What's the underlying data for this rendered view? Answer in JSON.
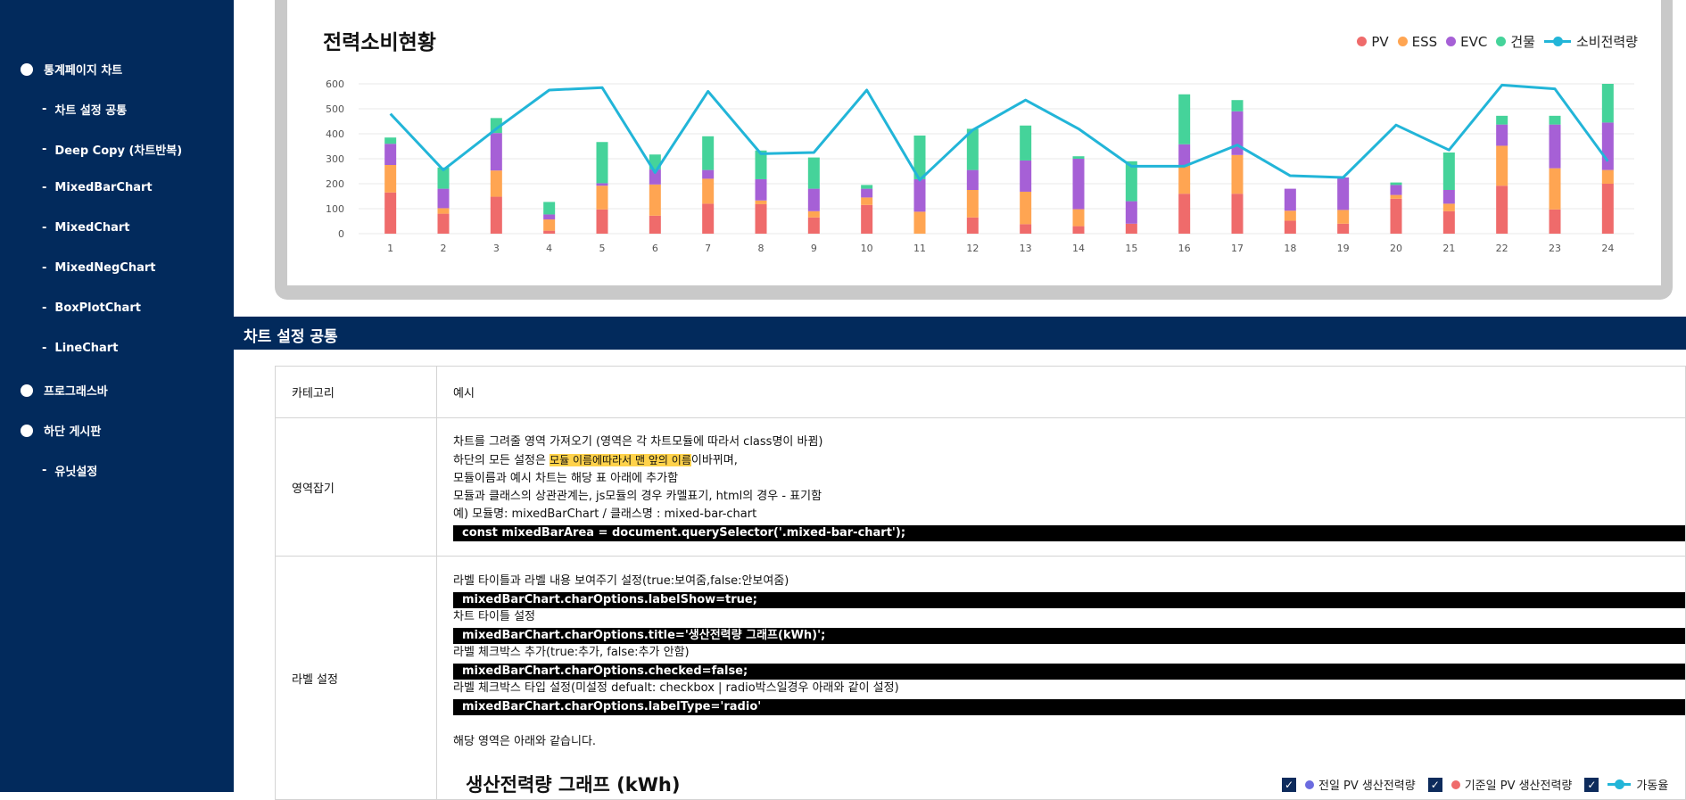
{
  "sidebar": {
    "items": [
      {
        "label": "통계페이지 차트",
        "level": "top"
      },
      {
        "label": "차트 설정 공통",
        "level": "sub"
      },
      {
        "label": "Deep Copy (차트반복)",
        "level": "sub"
      },
      {
        "label": "MixedBarChart",
        "level": "sub"
      },
      {
        "label": "MixedChart",
        "level": "sub"
      },
      {
        "label": "MixedNegChart",
        "level": "sub"
      },
      {
        "label": "BoxPlotChart",
        "level": "sub"
      },
      {
        "label": "LineChart",
        "level": "sub"
      },
      {
        "label": "프로그래스바",
        "level": "top"
      },
      {
        "label": "하단 게시판",
        "level": "top"
      },
      {
        "label": "유닛설정",
        "level": "sub"
      }
    ]
  },
  "chart": {
    "title": "전력소비현황",
    "legend": [
      {
        "label": "PV",
        "color": "#ef6b6b",
        "kind": "dot"
      },
      {
        "label": "ESS",
        "color": "#ffa552",
        "kind": "dot"
      },
      {
        "label": "EVC",
        "color": "#a660d6",
        "kind": "dot"
      },
      {
        "label": "건물",
        "color": "#45d39a",
        "kind": "dot"
      },
      {
        "label": "소비전력량",
        "color": "#22b5d8",
        "kind": "line"
      }
    ]
  },
  "chart_data": {
    "type": "bar",
    "title": "전력소비현황",
    "categories": [
      "1",
      "2",
      "3",
      "4",
      "5",
      "6",
      "7",
      "8",
      "9",
      "10",
      "11",
      "12",
      "13",
      "14",
      "15",
      "16",
      "17",
      "18",
      "19",
      "20",
      "21",
      "22",
      "23",
      "24"
    ],
    "ylim": [
      0,
      600
    ],
    "yticks": [
      0,
      100,
      200,
      300,
      400,
      500,
      600
    ],
    "grid": true,
    "legend_position": "top-right",
    "stacked": true,
    "series": [
      {
        "name": "PV",
        "color": "#ef6b6b",
        "values": [
          165,
          80,
          148,
          12,
          97,
          72,
          120,
          118,
          65,
          115,
          0,
          65,
          38,
          30,
          40,
          160,
          160,
          52,
          40,
          140,
          90,
          192,
          97,
          200
        ]
      },
      {
        "name": "ESS",
        "color": "#ffa552",
        "values": [
          110,
          22,
          105,
          45,
          95,
          125,
          100,
          15,
          25,
          30,
          88,
          110,
          130,
          68,
          0,
          113,
          155,
          40,
          55,
          15,
          30,
          160,
          165,
          55
        ]
      },
      {
        "name": "EVC",
        "color": "#a660d6",
        "values": [
          85,
          78,
          150,
          20,
          10,
          60,
          35,
          85,
          90,
          35,
          130,
          80,
          125,
          202,
          90,
          85,
          175,
          88,
          130,
          40,
          55,
          85,
          175,
          190
        ]
      },
      {
        "name": "건물",
        "color": "#45d39a",
        "values": [
          25,
          85,
          60,
          50,
          165,
          60,
          135,
          115,
          125,
          15,
          175,
          165,
          140,
          10,
          160,
          200,
          45,
          0,
          0,
          10,
          150,
          35,
          35,
          155
        ]
      },
      {
        "name": "소비전력량",
        "type": "line",
        "color": "#22b5d8",
        "values": [
          480,
          255,
          420,
          575,
          585,
          245,
          570,
          320,
          325,
          575,
          215,
          415,
          535,
          420,
          270,
          270,
          355,
          232,
          225,
          435,
          335,
          595,
          580,
          290
        ]
      }
    ]
  },
  "section": {
    "title": "차트 설정 공통"
  },
  "table": {
    "header": {
      "category": "카테고리",
      "example": "예시"
    },
    "row1": {
      "category": "영역잡기",
      "line1": "차트를 그려줄 영역 가져오기 (영역은 각 차트모듈에 따라서 class명이 바뀜)",
      "line2_pre": "하단의 모든 설정은 ",
      "line2_hl": "모듈 이름에따라서 맨 앞의 이름",
      "line2_post": "이바뀌며,",
      "line3": "모듈이름과 예시 차트는 해당 표 아래에 추가함",
      "line4": "모듈과 클래스의 상관관계는, js모듈의 경우 카멜표기, html의 경우 - 표기함",
      "line5": "예) 모듈명: mixedBarChart / 클래스명 : mixed-bar-chart",
      "code": "const mixedBarArea = document.querySelector('.mixed-bar-chart');"
    },
    "row2": {
      "category": "라벨 설정",
      "d1": "라벨 타이틀과 라벨 내용 보여주기 설정(true:보여줌,false:안보여줌)",
      "c1": "mixedBarChart.charOptions.labelShow=true;",
      "d2": "차트 타이틀 설정",
      "c2": "mixedBarChart.charOptions.title='생산전력량 그래프(kWh)';",
      "d3": "라벨 체크박스 추가(true:추가, false:추가 안함)",
      "c3": "mixedBarChart.charOptions.checked=false;",
      "d4": "라벨 체크박스 타입 설정(미설정 defualt: checkbox | radio박스일경우 아래와 같이 설정)",
      "c4": "mixedBarChart.charOptions.labelType='radio'",
      "note": "해당 영역은 아래와 같습니다.",
      "preview_title": "생산전력량 그래프 (kWh)",
      "preview_legend": [
        {
          "label": "전일 PV 생산전력량",
          "color": "#6b6be0"
        },
        {
          "label": "기준일 PV 생산전력량",
          "color": "#ef6b6b"
        },
        {
          "label": "가동율",
          "color": "#22b5d8"
        }
      ],
      "check_mark": "✓"
    }
  }
}
